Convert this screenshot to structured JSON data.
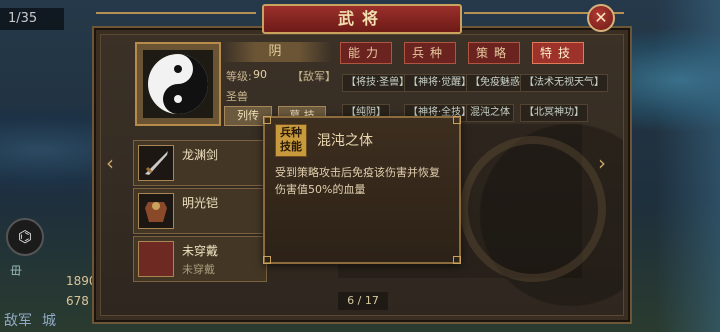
{
  "map": {
    "counter": "1/35",
    "side_icon": "⌬",
    "stats": {
      "label_top": "毌",
      "value_1": "1890",
      "value_2": "678",
      "label_left": "敌军",
      "label_right": "城"
    }
  },
  "panel": {
    "title": "武将",
    "close_label": "✕",
    "general": {
      "name": "阴",
      "level_label": "等级:",
      "level_value": "90",
      "faction": "【敌军】",
      "species": "圣兽",
      "buttons": [
        "列传",
        "幕 技"
      ]
    },
    "tabs": [
      {
        "label": "能力",
        "active": false
      },
      {
        "label": "兵种",
        "active": false
      },
      {
        "label": "策略",
        "active": false
      },
      {
        "label": "特技",
        "active": true
      }
    ],
    "skills": [
      "【将技·圣兽】",
      "【神将·觉醒】",
      "【免疫魅惑】",
      "【法术无视天气】",
      "【纯阴】",
      "【神将·全技】",
      "混沌之体",
      "【北冥神功】"
    ],
    "equipment": [
      {
        "name": "龙渊剑",
        "sub": ""
      },
      {
        "name": "明光铠",
        "sub": ""
      },
      {
        "name": "未穿戴",
        "sub": "未穿戴"
      }
    ],
    "page_indicator": "6 / 17"
  },
  "popup": {
    "badge": "兵种技能",
    "title": "混沌之体",
    "description": "受到策略攻击后免疫该伤害并恢复伤害值50%的血量"
  }
}
